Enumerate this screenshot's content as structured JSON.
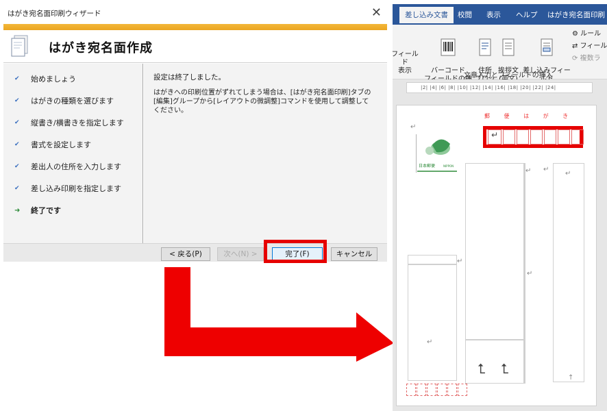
{
  "wizard": {
    "window_title": "はがき宛名面印刷ウィザード",
    "close_glyph": "✕",
    "header_title": "はがき宛名面作成",
    "steps": [
      {
        "label": "始めましょう",
        "state": "done"
      },
      {
        "label": "はがきの種類を選びます",
        "state": "done"
      },
      {
        "label": "縦書き/横書きを指定します",
        "state": "done"
      },
      {
        "label": "書式を設定します",
        "state": "done"
      },
      {
        "label": "差出人の住所を入力します",
        "state": "done"
      },
      {
        "label": "差し込み印刷を指定します",
        "state": "done"
      },
      {
        "label": "終了です",
        "state": "current"
      }
    ],
    "message_done": "設定は終了しました。",
    "message_detail": "はがきへの印刷位置がずれてしまう場合は、[はがき宛名面印刷]タブの[編集]グループから[レイアウトの微調整]コマンドを使用して調整してください。",
    "buttons": {
      "back": "< 戻る(P)",
      "next": "次へ(N) >",
      "finish": "完了(F)",
      "cancel": "キャンセル"
    },
    "highlight_color": "#e60000"
  },
  "word": {
    "tabs": [
      "差し込み文書",
      "校閲",
      "表示",
      "ヘルプ",
      "はがき宛名面印刷"
    ],
    "active_tab": "差し込み文書",
    "ribbon": {
      "field_display": "フィールド\n表示",
      "barcode": "バーコード\nフィールドの挿入",
      "address_block": "住所\nブロック",
      "greeting": "挨拶文\n(英文)",
      "insert_merge_field": "差し込みフィールド\nの挿入",
      "rules": "ルール",
      "field_match": "フィール",
      "update_labels": "複数ラ",
      "group_label": "文章入力とフィールドの挿入"
    },
    "ruler_text": "|2|  |4|  |6|  |8|  |10|  |12|  |14|  |16|  |18|  |20|  |22|  |24|",
    "postcard": {
      "heading": "郵 便 は が き",
      "stamp_text": "日本郵便",
      "stamp_brand": "NIPPON"
    },
    "brand_color": "#2b579a"
  },
  "arrow_color": "#ee0000"
}
